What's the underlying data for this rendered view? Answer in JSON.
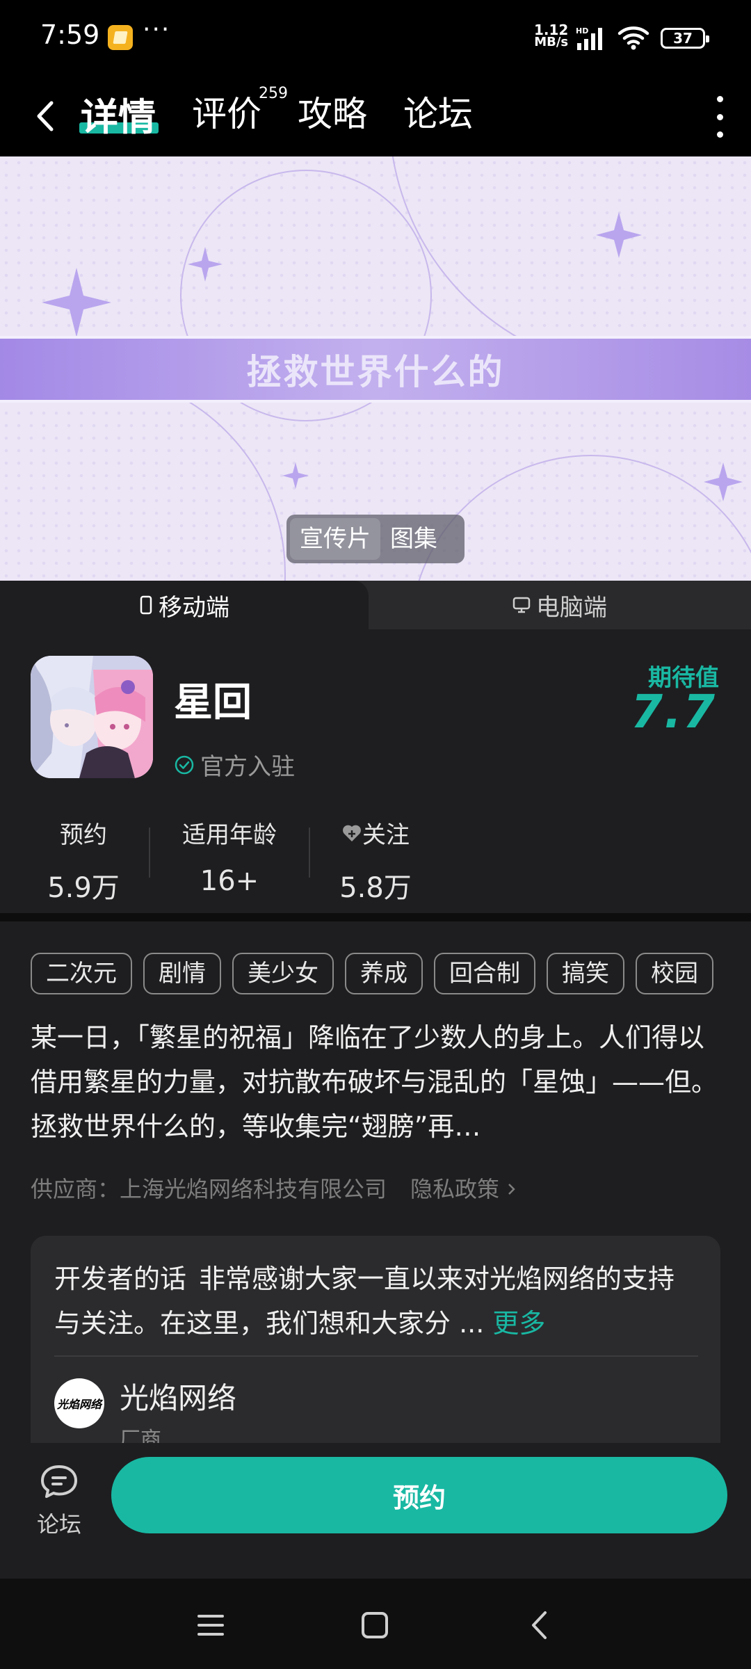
{
  "status_bar": {
    "time": "7:59",
    "more": "···",
    "net_speed_value": "1.12",
    "net_speed_unit": "MB/s",
    "hd_label": "HD",
    "battery": "37"
  },
  "header": {
    "tabs": [
      {
        "label": "详情"
      },
      {
        "label": "评价"
      },
      {
        "label": "攻略"
      },
      {
        "label": "论坛"
      }
    ],
    "reviews_count": "259"
  },
  "banner": {
    "title": "拯救世界什么的",
    "toggle": [
      "宣传片",
      "图集"
    ],
    "active_toggle": "宣传片"
  },
  "platform": {
    "mobile": "移动端",
    "pc": "电脑端",
    "active": "移动端"
  },
  "app": {
    "name": "星回",
    "official": "官方入驻",
    "score_label": "期待值",
    "score": "7.7"
  },
  "stats": [
    {
      "label": "预约",
      "value": "5.9万"
    },
    {
      "label": "适用年龄",
      "value": "16+"
    },
    {
      "label": "关注",
      "value": "5.8万"
    }
  ],
  "tags": [
    "二次元",
    "剧情",
    "美少女",
    "养成",
    "回合制",
    "搞笑",
    "校园"
  ],
  "description": "某一日，「繁星的祝福」降临在了少数人的身上。人们得以借用繁星的力量，对抗散布破坏与混乱的「星蚀」——但。 拯救世界什么的，等收集完“翅膀”再…",
  "supplier": {
    "text": "供应商：上海光焰网络科技有限公司",
    "privacy": "隐私政策"
  },
  "developer": {
    "heading": "开发者的话",
    "text": "非常感谢大家一直以来对光焰网络的支持与关注。在这里，我们想和大家分 ...",
    "more": "更多",
    "avatar_text": "光焰网络",
    "name": "光焰网络",
    "role": "厂商"
  },
  "bottom": {
    "forum_label": "论坛",
    "reserve": "预约"
  },
  "colors": {
    "accent": "#19b8a3",
    "background": "#1e1e20",
    "banner_strip": "#a389e6"
  }
}
